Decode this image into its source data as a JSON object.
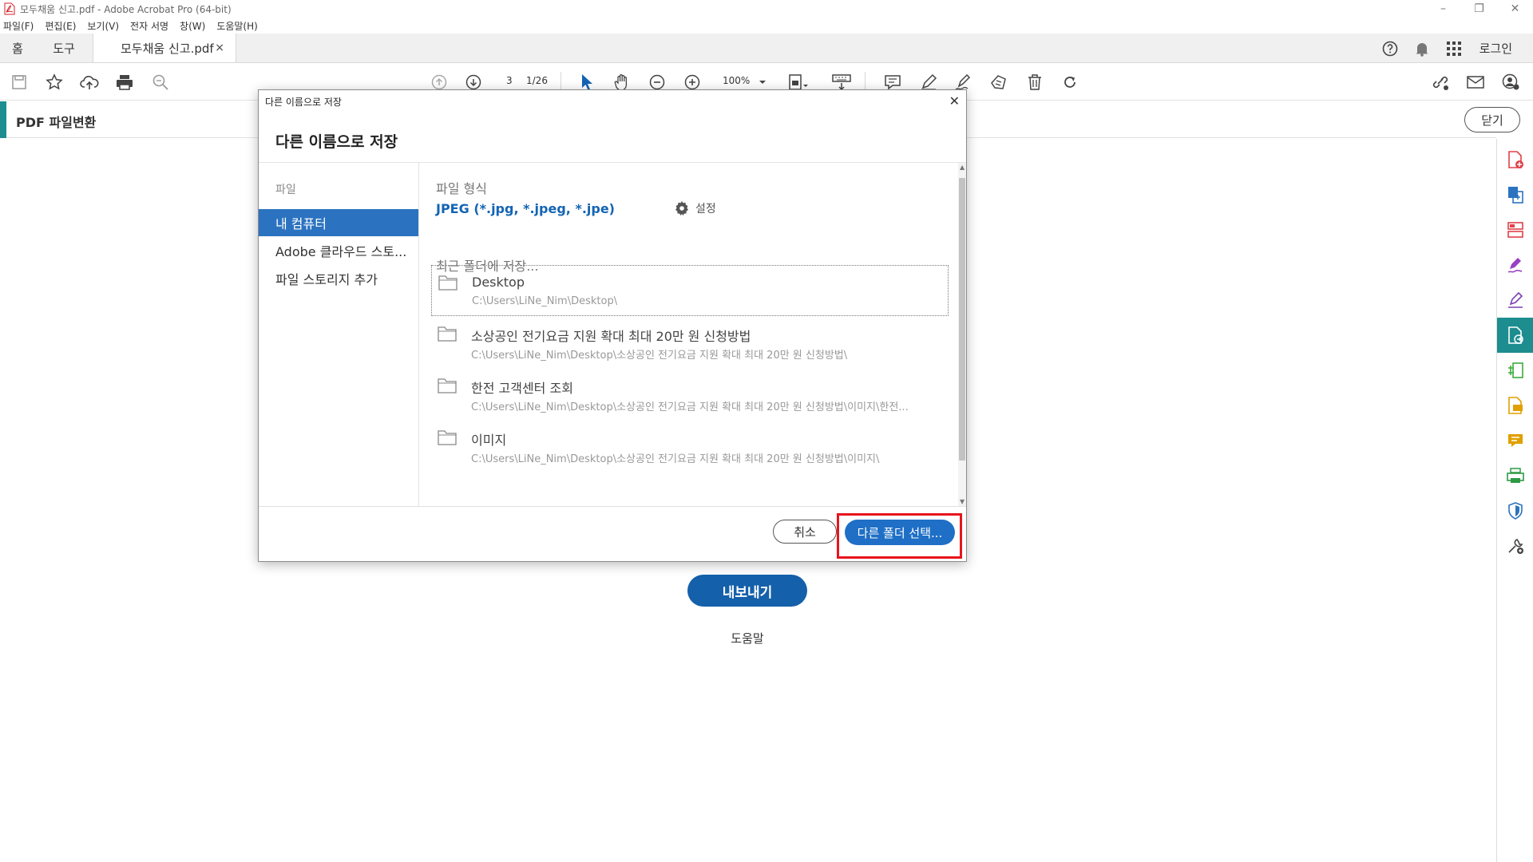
{
  "window": {
    "title": "모두채움 신고.pdf - Adobe Acrobat Pro (64-bit)",
    "controls": [
      "–",
      "❐",
      "✕"
    ]
  },
  "menu": [
    "파일(F)",
    "편집(E)",
    "보기(V)",
    "전자 서명",
    "창(W)",
    "도움말(H)"
  ],
  "tabs": {
    "home": "홈",
    "tools": "도구",
    "document": "모두채움 신고.pdf",
    "close": "×",
    "login": "로그인"
  },
  "toolbar": {
    "page_current": "3",
    "page_total": "1/26",
    "zoom": "100%"
  },
  "convert": {
    "title": "PDF 파일변환",
    "close_label": "닫기"
  },
  "main": {
    "export_label": "내보내기",
    "help_label": "도움말"
  },
  "dialog": {
    "caption": "다른 이름으로 저장",
    "heading": "다른 이름으로 저장",
    "close": "✕",
    "sidebar": {
      "category": "파일",
      "items": [
        "내 컴퓨터",
        "Adobe 클라우드 스토...",
        "파일 스토리지 추가"
      ]
    },
    "format_label": "파일 형식",
    "format_value": "JPEG (*.jpg, *.jpeg, *.jpe)",
    "settings_label": "설정",
    "recent_label": "최근 폴더에 저장...",
    "folders": [
      {
        "name": "Desktop",
        "path": "C:\\Users\\LiNe_Nim\\Desktop\\"
      },
      {
        "name": "소상공인 전기요금 지원 확대 최대 20만 원 신청방법",
        "path": "C:\\Users\\LiNe_Nim\\Desktop\\소상공인 전기요금 지원 확대 최대 20만 원 신청방법\\"
      },
      {
        "name": "한전 고객센터 조회",
        "path": "C:\\Users\\LiNe_Nim\\Desktop\\소상공인 전기요금 지원 확대 최대 20만 원 신청방법\\이미지\\한전..."
      },
      {
        "name": "이미지",
        "path": "C:\\Users\\LiNe_Nim\\Desktop\\소상공인 전기요금 지원 확대 최대 20만 원 신청방법\\이미지\\"
      }
    ],
    "cancel_label": "취소",
    "choose_label": "다른 폴더 선택..."
  },
  "colors": {
    "accent_teal": "#1d8d8f",
    "primary_blue": "#1f6fc6",
    "highlight_red": "#e8141c"
  }
}
